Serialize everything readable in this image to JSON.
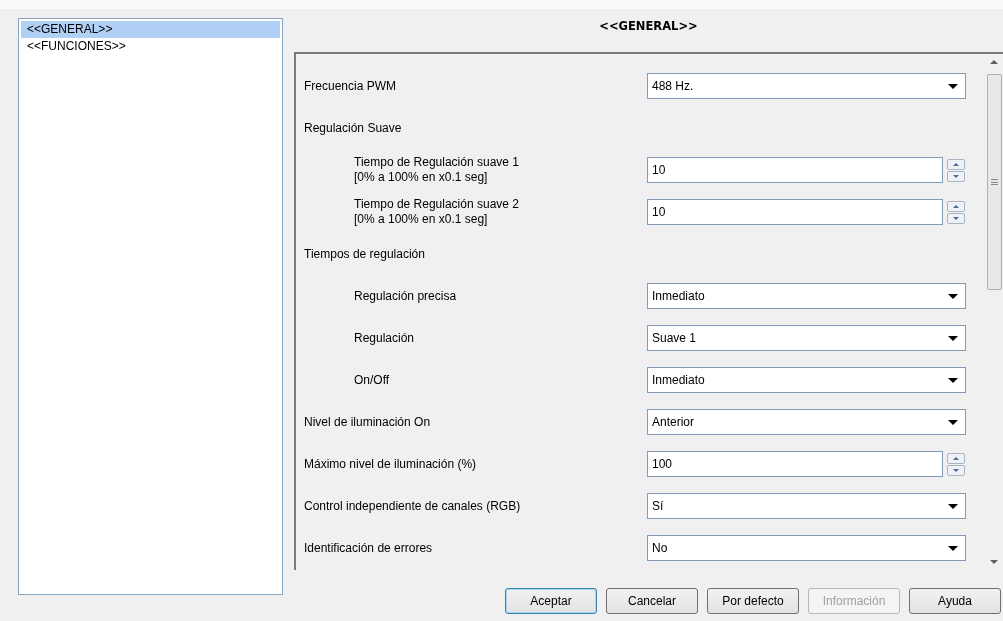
{
  "tree": {
    "items": [
      {
        "label": "<<GENERAL>>",
        "selected": true
      },
      {
        "label": "<<FUNCIONES>>",
        "selected": false
      }
    ]
  },
  "title": "<<GENERAL>>",
  "parameters": [
    {
      "kind": "select",
      "label": "Frecuencia PWM",
      "indented": false,
      "value": "488 Hz."
    },
    {
      "kind": "heading",
      "label": "Regulación Suave",
      "indented": false
    },
    {
      "kind": "spin",
      "label": "Tiempo de Regulación suave 1",
      "note": "[0% a 100% en x0.1 seg]",
      "indented": true,
      "value": "10"
    },
    {
      "kind": "spin",
      "label": "Tiempo de Regulación suave 2",
      "note": "[0% a 100% en x0.1 seg]",
      "indented": true,
      "value": "10"
    },
    {
      "kind": "heading",
      "label": "Tiempos de regulación",
      "indented": false
    },
    {
      "kind": "select",
      "label": "Regulación precisa",
      "indented": true,
      "value": "Inmediato"
    },
    {
      "kind": "select",
      "label": "Regulación",
      "indented": true,
      "value": "Suave 1"
    },
    {
      "kind": "select",
      "label": "On/Off",
      "indented": true,
      "value": "Inmediato"
    },
    {
      "kind": "select",
      "label": "Nivel de iluminación On",
      "indented": false,
      "value": "Anterior"
    },
    {
      "kind": "spin",
      "label": "Máximo nivel de iluminación (%)",
      "indented": false,
      "value": "100"
    },
    {
      "kind": "select",
      "label": "Control independiente de canales (RGB)",
      "indented": false,
      "value": "Sí"
    },
    {
      "kind": "select",
      "label": "Identificación de errores",
      "indented": false,
      "value": "No"
    }
  ],
  "buttons": [
    {
      "label": "Aceptar",
      "default": true,
      "disabled": false
    },
    {
      "label": "Cancelar",
      "default": false,
      "disabled": false
    },
    {
      "label": "Por defecto",
      "default": false,
      "disabled": false
    },
    {
      "label": "Información",
      "default": false,
      "disabled": true
    },
    {
      "label": "Ayuda",
      "default": false,
      "disabled": false
    }
  ]
}
